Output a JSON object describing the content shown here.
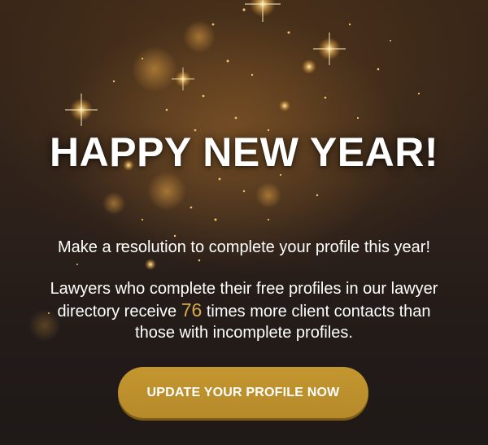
{
  "banner": {
    "title": "HAPPY NEW YEAR!",
    "resolution": "Make a resolution to complete your profile this year!",
    "body_before": "Lawyers who complete their free profiles in our lawyer directory receive",
    "highlight_number": "76",
    "body_after": "times more client contacts than those with incomplete profiles.",
    "cta_label": "UPDATE YOUR PROFILE NOW"
  },
  "colors": {
    "accent_gold": "#d9a94a",
    "button_gold": "#b68a2a",
    "background_dark": "#221b18",
    "text_white": "#ffffff"
  }
}
